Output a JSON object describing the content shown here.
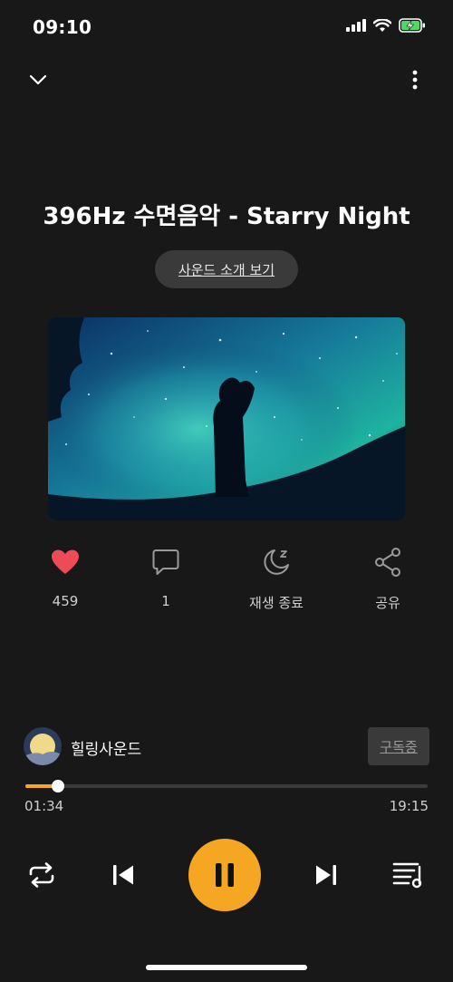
{
  "status": {
    "time": "09:10"
  },
  "track": {
    "title": "396Hz 수면음악 - Starry Night",
    "intro_label": "사운드 소개 보기"
  },
  "actions": {
    "like": {
      "icon": "heart-icon",
      "count": "459",
      "color": "#ef4a58"
    },
    "comment": {
      "icon": "comment-icon",
      "count": "1"
    },
    "sleep": {
      "icon": "moon-icon",
      "label": "재생 종료"
    },
    "share": {
      "icon": "share-icon",
      "label": "공유"
    }
  },
  "channel": {
    "name": "힐링사운드",
    "subscribe_label": "구독중"
  },
  "player": {
    "current_time": "01:34",
    "total_time": "19:15",
    "progress_fraction": 0.0814,
    "accent_color": "#f5a623"
  },
  "controls": {
    "repeat": "repeat-icon",
    "previous": "skip-previous-icon",
    "pause": "pause-icon",
    "next": "skip-next-icon",
    "playlist": "playlist-icon"
  }
}
